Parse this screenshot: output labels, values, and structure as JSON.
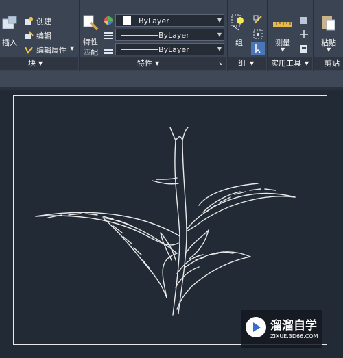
{
  "ribbon": {
    "block_panel": {
      "insert_label": "插入",
      "create_label": "创建",
      "edit_label": "编辑",
      "edit_attr_label": "编辑属性",
      "footer": "块"
    },
    "properties_panel": {
      "match_label_line1": "特性",
      "match_label_line2": "匹配",
      "color_value": "ByLayer",
      "linetype_value": "ByLayer",
      "lineweight_value": "ByLayer",
      "footer": "特性"
    },
    "group_panel": {
      "group_label": "组",
      "footer": "组"
    },
    "utilities_panel": {
      "measure_label": "测量",
      "footer": "实用工具"
    },
    "clipboard_panel": {
      "paste_label": "粘贴",
      "footer": "剪贴板"
    }
  },
  "watermark": {
    "title": "溜溜自学",
    "url": "ZIXUE.3D66.COM"
  },
  "colors": {
    "ribbon_bg": "#3b4453",
    "canvas_bg": "#222b35",
    "line": "#e8e8e8"
  }
}
